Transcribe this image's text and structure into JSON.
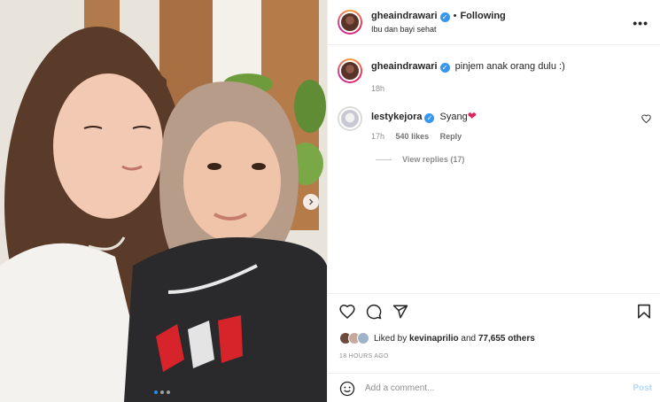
{
  "header": {
    "username": "gheaindrawari",
    "separator": "•",
    "follow_status": "Following",
    "subtitle": "Ibu dan bayi sehat",
    "more_label": "•••"
  },
  "caption": {
    "username": "gheaindrawari",
    "text": "pinjem anak orang dulu :)",
    "time": "18h"
  },
  "comment": {
    "username": "lestykejora",
    "text": "Syang",
    "time": "17h",
    "likes": "540 likes",
    "reply": "Reply",
    "view_replies": "View replies (17)"
  },
  "likes": {
    "prefix": "Liked by ",
    "user": "kevinaprilio",
    "middle": " and ",
    "others": "77,655 others"
  },
  "timestamp": "18 HOURS AGO",
  "comment_box": {
    "placeholder": "Add a comment...",
    "post_label": "Post"
  },
  "carousel": {
    "current": 1,
    "total": 3
  },
  "colors": {
    "accent": "#3797f0",
    "heart": "#ed4956",
    "muted": "#8e8e8e"
  },
  "icons": [
    "heart-icon",
    "comment-icon",
    "share-icon",
    "bookmark-icon",
    "emoji-icon",
    "verified-icon",
    "chevron-right-icon",
    "more-icon"
  ]
}
